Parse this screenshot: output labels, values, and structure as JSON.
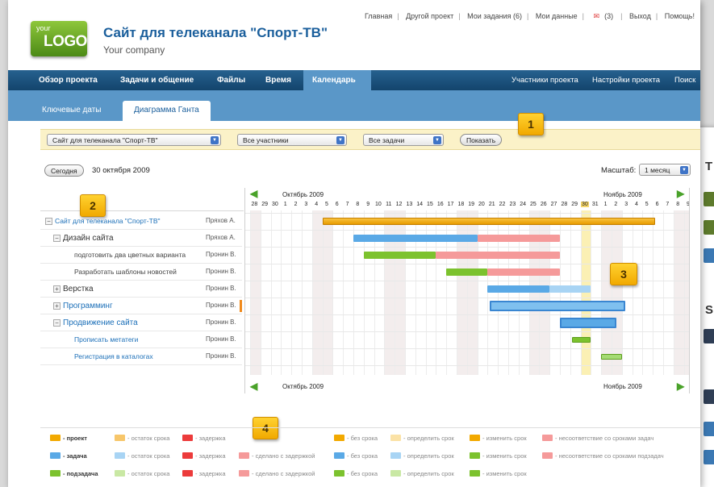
{
  "toplinks": [
    "Главная",
    "Другой проект",
    "Мои задания (6)",
    "Мои данные",
    "(3)",
    "Выход",
    "Помощь!"
  ],
  "logo": {
    "line1": "your",
    "line2": "LOGO"
  },
  "site": {
    "title": "Сайт для телеканала \"Спорт-ТВ\"",
    "subtitle": "Your company"
  },
  "mainnav": {
    "items": [
      "Обзор проекта",
      "Задачи и общение",
      "Файлы",
      "Время",
      "Календарь"
    ],
    "active": "Календарь",
    "right": [
      "Участники проекта",
      "Настройки проекта",
      "Поиск"
    ]
  },
  "subnav": {
    "tabs": [
      "Ключевые даты",
      "Диаграмма Ганта"
    ],
    "active": "Диаграмма Ганта"
  },
  "filters": {
    "project": "Сайт для телеканала \"Спорт-ТВ\"",
    "members": "Все участники",
    "tasks": "Все задачи",
    "show_button": "Показать"
  },
  "today": {
    "button": "Сегодня",
    "date": "30 октября 2009"
  },
  "scale": {
    "label": "Масштаб:",
    "value": "1 месяц"
  },
  "markers": [
    "1",
    "2",
    "3",
    "4"
  ],
  "calendar": {
    "month_left": "Октябрь 2009",
    "month_right": "Ноябрь 2009",
    "days": [
      "28",
      "29",
      "30",
      "1",
      "2",
      "3",
      "4",
      "5",
      "6",
      "7",
      "8",
      "9",
      "10",
      "11",
      "12",
      "13",
      "14",
      "15",
      "16",
      "17",
      "18",
      "19",
      "20",
      "21",
      "22",
      "23",
      "24",
      "25",
      "26",
      "27",
      "28",
      "29",
      "30",
      "31",
      "1",
      "2",
      "3",
      "4",
      "5",
      "6",
      "7",
      "8",
      "9"
    ]
  },
  "tasks": [
    {
      "name": "Сайт для телеканала \"Спорт-ТВ\"",
      "who": "Пряхов А.",
      "level": 0,
      "toggle": "−"
    },
    {
      "name": "Дизайн сайта",
      "who": "Пряхов А.",
      "level": 1,
      "toggle": "−"
    },
    {
      "name": "подготовить два цветных варианта",
      "who": "Пронин В.",
      "level": 2,
      "toggle": ""
    },
    {
      "name": "Разработать шаблоны новостей",
      "who": "Пронин В.",
      "level": 2,
      "toggle": ""
    },
    {
      "name": "Верстка",
      "who": "Пронин В.",
      "level": 1,
      "toggle": "+"
    },
    {
      "name": "Программинг",
      "who": "Пронин В.",
      "level": 1,
      "toggle": "+"
    },
    {
      "name": "Продвижение сайта",
      "who": "Пронин В.",
      "level": 1,
      "toggle": "−"
    },
    {
      "name": "Прописать метатеги",
      "who": "Пронин В.",
      "level": 2,
      "toggle": ""
    },
    {
      "name": "Регистрация в каталогах",
      "who": "Пронин В.",
      "level": 2,
      "toggle": ""
    }
  ],
  "legend": {
    "row1": [
      "- проект",
      "- остаток срока",
      "- задержка",
      "- без срока",
      "- определить срок",
      "- изменить срок",
      "- несоответствие со сроками задач"
    ],
    "row2": [
      "- задача",
      "- остаток срока",
      "- задержка",
      "- сделано с задержкой",
      "- без срока",
      "- определить срок",
      "- изменить срок",
      "- несоответствие со сроками подзадач"
    ],
    "row3": [
      "- подзадача",
      "- остаток срока",
      "- задержка",
      "- сделано с задержкой",
      "- без срока",
      "- определить срок",
      "- изменить срок"
    ]
  },
  "colors": {
    "project": "#f2a900",
    "task": "#5aa9e6",
    "subtask": "#7cc22e",
    "delay": "#f59a9a",
    "nav": "#1b4f7c",
    "accent": "#5a97c8"
  }
}
